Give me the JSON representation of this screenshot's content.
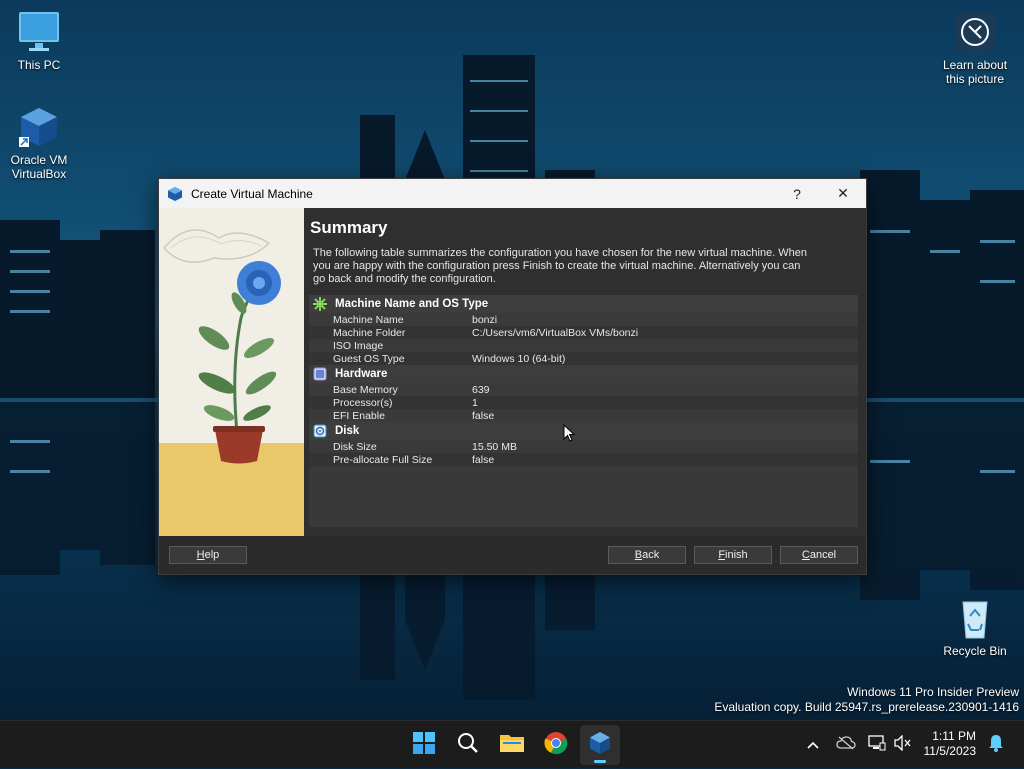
{
  "desktop": {
    "icons": [
      {
        "label": "This PC"
      },
      {
        "label_line1": "Oracle VM",
        "label_line2": "VirtualBox"
      },
      {
        "label_line1": "Learn about",
        "label_line2": "this picture"
      },
      {
        "label": "Recycle Bin"
      }
    ]
  },
  "dialog": {
    "title": "Create Virtual Machine",
    "help_glyph": "?",
    "close_glyph": "✕",
    "heading": "Summary",
    "intro": "The following table summarizes the configuration you have chosen for the new virtual machine. When you are happy with the configuration press Finish to create the virtual machine. Alternatively you can go back and modify the configuration.",
    "sections": [
      {
        "title": "Machine Name and OS Type",
        "icon": "star-icon",
        "rows": [
          {
            "key": "Machine Name",
            "value": "bonzi"
          },
          {
            "key": "Machine Folder",
            "value": "C:/Users/vm6/VirtualBox VMs/bonzi"
          },
          {
            "key": "ISO Image",
            "value": ""
          },
          {
            "key": "Guest OS Type",
            "value": "Windows 10 (64-bit)"
          }
        ]
      },
      {
        "title": "Hardware",
        "icon": "chip-icon",
        "rows": [
          {
            "key": "Base Memory",
            "value": "639"
          },
          {
            "key": "Processor(s)",
            "value": "1"
          },
          {
            "key": "EFI Enable",
            "value": "false"
          }
        ]
      },
      {
        "title": "Disk",
        "icon": "disk-icon",
        "rows": [
          {
            "key": "Disk Size",
            "value": "15.50 MB"
          },
          {
            "key": "Pre-allocate Full Size",
            "value": "false"
          }
        ]
      }
    ],
    "buttons": {
      "help": {
        "first": "H",
        "rest": "elp"
      },
      "back": {
        "first": "B",
        "rest": "ack"
      },
      "finish": {
        "first": "F",
        "rest": "inish"
      },
      "cancel": {
        "first": "C",
        "rest": "ancel"
      }
    }
  },
  "watermark": {
    "line1": "Windows 11 Pro Insider Preview",
    "line2": "Evaluation copy. Build 25947.rs_prerelease.230901-1416"
  },
  "taskbar": {
    "apps": [
      "start-icon",
      "search-icon",
      "file-explorer-icon",
      "chrome-icon",
      "virtualbox-icon"
    ],
    "time": "1:11 PM",
    "date": "11/5/2023"
  },
  "colors": {
    "accent": "#60cdff",
    "dialog_bg": "#2f2f2f"
  }
}
